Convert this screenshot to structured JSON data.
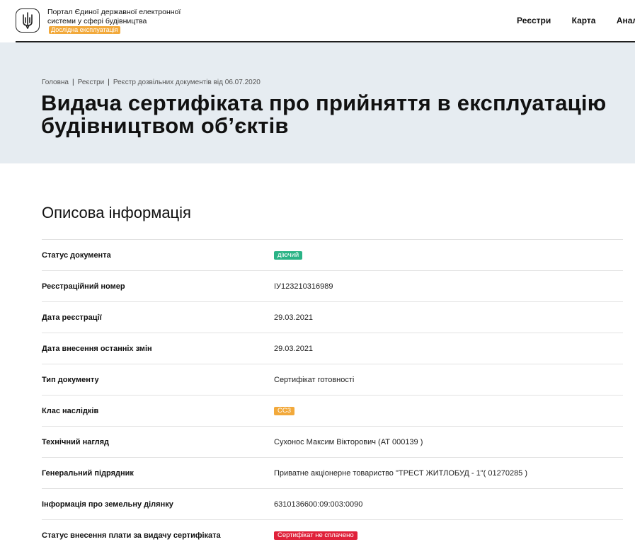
{
  "header": {
    "portal_title": "Портал Єдиної державної електронної системи у сфері будівництва",
    "beta_badge": "Дослідна експлуатація",
    "nav": [
      "Реєстри",
      "Карта",
      "Аналіти"
    ]
  },
  "breadcrumb": [
    "Головна",
    "Реєстри",
    "Реєстр дозвільних документів від 06.07.2020"
  ],
  "page_title_line1": "Видача сертифіката про прийняття в експлуатацію",
  "page_title_line2": "будівництвом об’єктів",
  "section_title": "Описова інформація",
  "rows": [
    {
      "label": "Статус документа",
      "value": "діючий",
      "type": "tag",
      "tag_color": "#2ab386"
    },
    {
      "label": "Реєстраційний номер",
      "value": "ІУ123210316989"
    },
    {
      "label": "Дата реєстрації",
      "value": "29.03.2021"
    },
    {
      "label": "Дата внесення останніх змін",
      "value": "29.03.2021"
    },
    {
      "label": "Тип документу",
      "value": "Сертифікат готовності"
    },
    {
      "label": "Клас наслідків",
      "value": "СС3",
      "type": "tag",
      "tag_color": "#f2a93b"
    },
    {
      "label": "Технічний нагляд",
      "value": "Сухонос Максим Вікторович (АТ 000139 )"
    },
    {
      "label": "Генеральний підрядник",
      "value": "Приватне акціонерне товариство \"ТРЕСТ ЖИТЛОБУД - 1\"( 01270285 )"
    },
    {
      "label": "Інформація про земельну ділянку",
      "value": "6310136600:09:003:0090"
    },
    {
      "label": "Статус внесення плати за видачу сертифіката",
      "value": "Сертифікат не сплачено",
      "type": "tag",
      "tag_color": "#e0213a"
    }
  ]
}
